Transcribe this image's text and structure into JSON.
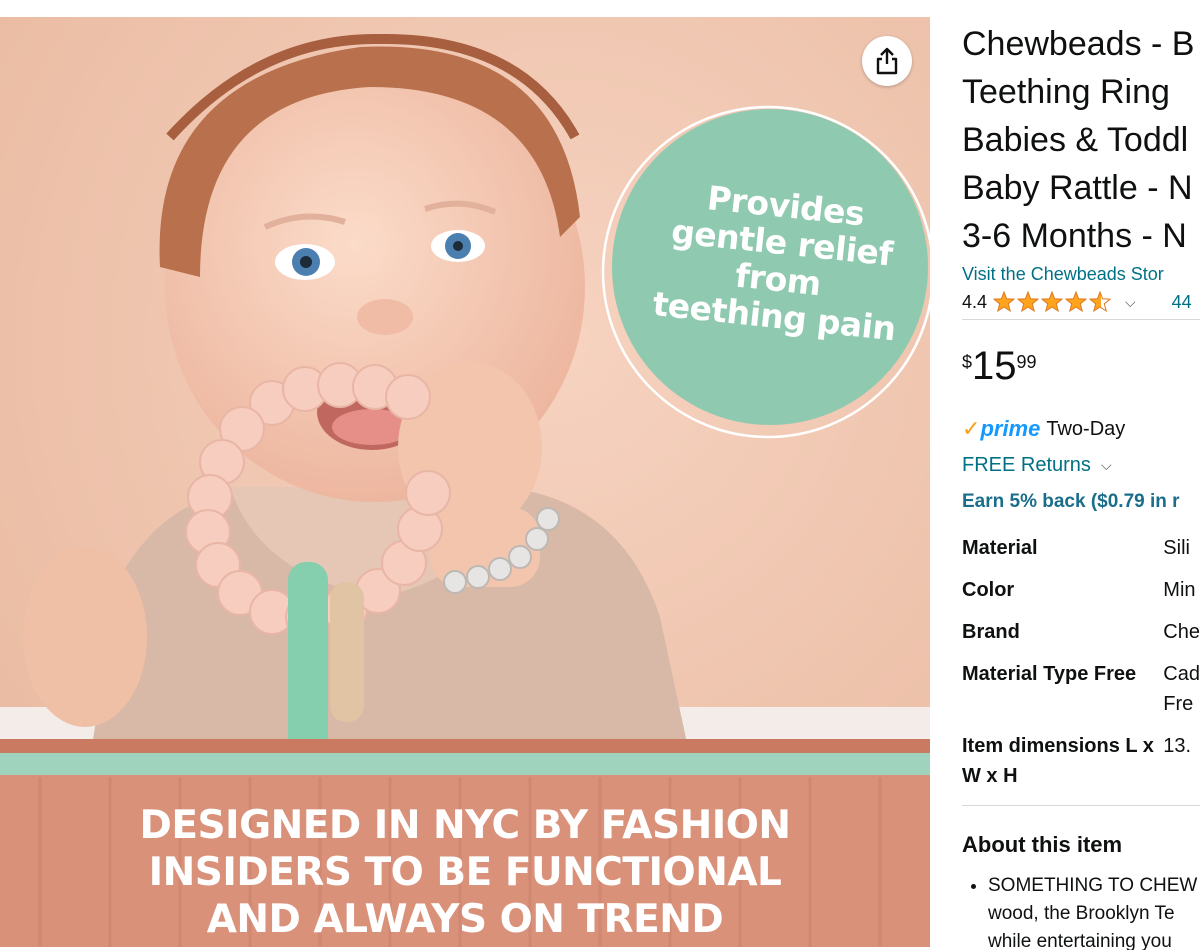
{
  "image": {
    "bubble_lines": [
      "Provides",
      "gentle relief",
      "from",
      "teething pain"
    ],
    "banner_lines": [
      "DESIGNED IN NYC BY FASHION",
      "INSIDERS TO BE FUNCTIONAL",
      "AND ALWAYS ON TREND"
    ],
    "share_icon": "share-icon"
  },
  "product": {
    "title_lines": [
      "Chewbeads - B",
      "Teething Ring",
      "Babies & Toddl",
      "Baby Rattle - N",
      "3-6 Months - N"
    ],
    "store_link": "Visit the Chewbeads Stor",
    "rating": "4.4",
    "rating_stars": 4.4,
    "ratings_count": "44",
    "price": {
      "symbol": "$",
      "whole": "15",
      "fraction": "99"
    },
    "prime": {
      "check": "✓",
      "word": "prime",
      "delivery": "Two-Day"
    },
    "returns": "FREE Returns",
    "earn": "Earn 5% back ($0.79 in r",
    "specs": [
      {
        "label": "Material",
        "value": "Sili"
      },
      {
        "label": "Color",
        "value": "Min"
      },
      {
        "label": "Brand",
        "value": "Che"
      },
      {
        "label_lines": [
          "Material Type Free"
        ],
        "value_lines": [
          "Cad",
          "Fre"
        ]
      },
      {
        "label_lines": [
          "Item dimensions L x",
          "W x H"
        ],
        "value_lines": [
          "13."
        ]
      }
    ],
    "about_heading": "About this item",
    "bullet_lines": [
      "SOMETHING TO CHEW",
      "wood, the Brooklyn Te",
      "while entertaining you"
    ]
  },
  "colors": {
    "background_peach": "#f1c8b1",
    "bubble_mint": "#8fcab0",
    "banner_terracotta": "#d9917a",
    "stripe_mint": "#9fd3bd",
    "link": "#007185",
    "star": "#ffa41c"
  }
}
